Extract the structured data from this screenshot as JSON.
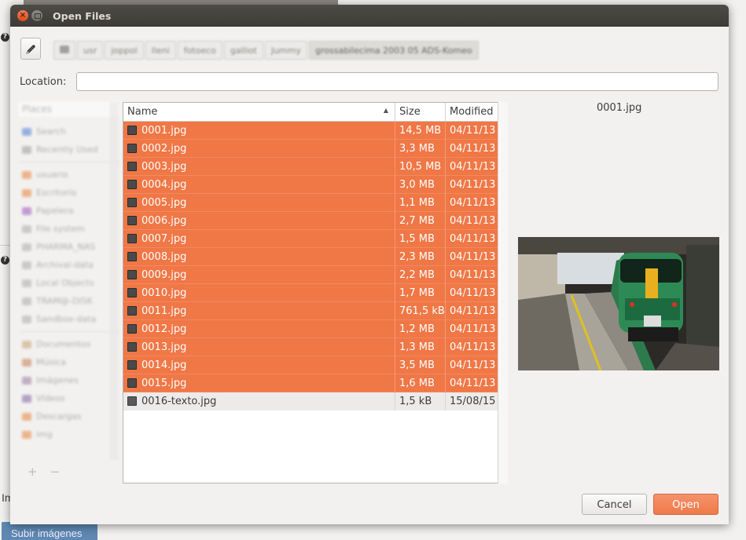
{
  "dialog": {
    "title": "Open Files",
    "close_glyph": "×",
    "location_label": "Location:",
    "location_value": "",
    "cancel_label": "Cancel",
    "open_label": "Open",
    "preview_filename": "0001.jpg"
  },
  "pathbar": {
    "crumbs": [
      "",
      "usr",
      "joppol",
      "lleni",
      "fotoeco",
      "galliot",
      "Jummy",
      "grossabilecima 2003 05 ADS-Komeo"
    ]
  },
  "places": {
    "header": "Places",
    "items": [
      "Search",
      "Recently Used",
      "usuario",
      "Escritorio",
      "Papelera",
      "File system",
      "PHARMA_NAS",
      "Archival-data",
      "Local Objects",
      "TRAM@-DISK",
      "Sandbox-data",
      "Documentos",
      "Música",
      "Imágenes",
      "Vídeos",
      "Descargas",
      "img"
    ],
    "add_glyph": "+",
    "remove_glyph": "−"
  },
  "filelist": {
    "headers": {
      "name": "Name",
      "size": "Size",
      "modified": "Modified"
    },
    "sort_glyph": "▲",
    "rows": [
      {
        "name": "0001.jpg",
        "size": "14,5 MB",
        "modified": "04/11/13",
        "selected": true
      },
      {
        "name": "0002.jpg",
        "size": "3,3 MB",
        "modified": "04/11/13",
        "selected": true
      },
      {
        "name": "0003.jpg",
        "size": "10,5 MB",
        "modified": "04/11/13",
        "selected": true
      },
      {
        "name": "0004.jpg",
        "size": "3,0 MB",
        "modified": "04/11/13",
        "selected": true
      },
      {
        "name": "0005.jpg",
        "size": "1,1 MB",
        "modified": "04/11/13",
        "selected": true
      },
      {
        "name": "0006.jpg",
        "size": "2,7 MB",
        "modified": "04/11/13",
        "selected": true
      },
      {
        "name": "0007.jpg",
        "size": "1,5 MB",
        "modified": "04/11/13",
        "selected": true
      },
      {
        "name": "0008.jpg",
        "size": "2,3 MB",
        "modified": "04/11/13",
        "selected": true
      },
      {
        "name": "0009.jpg",
        "size": "2,2 MB",
        "modified": "04/11/13",
        "selected": true
      },
      {
        "name": "0010.jpg",
        "size": "1,7 MB",
        "modified": "04/11/13",
        "selected": true
      },
      {
        "name": "0011.jpg",
        "size": "761,5 kB",
        "modified": "04/11/13",
        "selected": true
      },
      {
        "name": "0012.jpg",
        "size": "1,2 MB",
        "modified": "04/11/13",
        "selected": true
      },
      {
        "name": "0013.jpg",
        "size": "1,3 MB",
        "modified": "04/11/13",
        "selected": true
      },
      {
        "name": "0014.jpg",
        "size": "3,5 MB",
        "modified": "04/11/13",
        "selected": true
      },
      {
        "name": "0015.jpg",
        "size": "1,6 MB",
        "modified": "04/11/13",
        "selected": true
      },
      {
        "name": "0016-texto.jpg",
        "size": "1,5 kB",
        "modified": "15/08/15",
        "selected": false
      }
    ]
  },
  "background": {
    "help_glyph": "?",
    "partial_label": "Im",
    "upload_button": "Subir imágenes"
  },
  "colors": {
    "selection": "#f07746",
    "open_button": "#ef7a4a",
    "titlebar": "#3c3b37",
    "close_button": "#df4a16"
  }
}
